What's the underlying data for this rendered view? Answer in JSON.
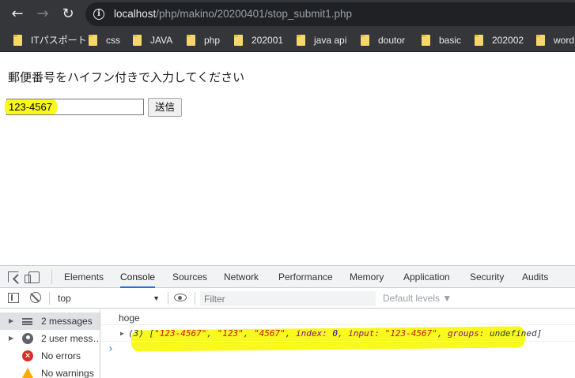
{
  "browser": {
    "url_host": "localhost",
    "url_path": "/php/makino/20200401/stop_submit1.php",
    "bookmarks": [
      {
        "label": "ITパスポート"
      },
      {
        "label": "css"
      },
      {
        "label": "JAVA"
      },
      {
        "label": "php"
      },
      {
        "label": "202001"
      },
      {
        "label": "java api"
      },
      {
        "label": "doutor"
      },
      {
        "label": "basic"
      },
      {
        "label": "202002"
      },
      {
        "label": "word"
      }
    ]
  },
  "page": {
    "prompt": "郵便番号をハイフン付きで入力してください",
    "zip_value": "123-4567",
    "submit_label": "送信"
  },
  "devtools": {
    "tabs": [
      "Elements",
      "Console",
      "Sources",
      "Network",
      "Performance",
      "Memory",
      "Application",
      "Security",
      "Audits"
    ],
    "active_tab": "Console",
    "context": "top",
    "filter_placeholder": "Filter",
    "levels": "Default levels ▼",
    "sidebar": [
      {
        "label": "2 messages"
      },
      {
        "label": "2 user mess…"
      },
      {
        "label": "No errors"
      },
      {
        "label": "No warnings"
      }
    ],
    "log": {
      "line1": "hoge",
      "array": {
        "count": "(3) [",
        "v1": "\"123-4567\"",
        "v2": "\"123\"",
        "v3": "\"4567\"",
        "index_key": "index: ",
        "index_val": "0",
        "input_key": "input: ",
        "input_val": "\"123-4567\"",
        "groups_key": "groups: ",
        "groups_val": "undefined",
        "close": "]"
      }
    },
    "highlight_color": "#f9f91e",
    "accent_color": "#1a73e8"
  }
}
